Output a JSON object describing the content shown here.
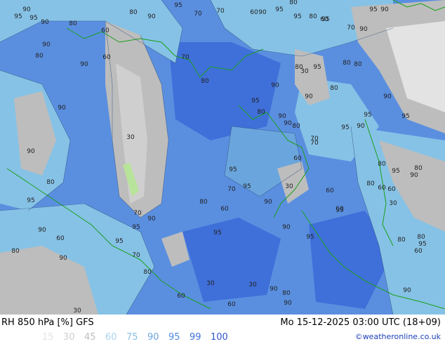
{
  "map": {
    "product": "RH 850 hPa [%] GFS",
    "datetime": "Mo 15-12-2025 03:00 UTC (18+09)",
    "credit": "©weatheronline.co.uk",
    "legend": [
      {
        "label": "15",
        "color": "#e3e3e3"
      },
      {
        "label": "30",
        "color": "#cfcfcf"
      },
      {
        "label": "45",
        "color": "#bdbdbd"
      },
      {
        "label": "60",
        "color": "#a8d4ee"
      },
      {
        "label": "75",
        "color": "#86c2e6"
      },
      {
        "label": "90",
        "color": "#6aa6dd"
      },
      {
        "label": "95",
        "color": "#5088dd"
      },
      {
        "label": "99",
        "color": "#3f6fd9"
      },
      {
        "label": "100",
        "color": "#2f55cf"
      }
    ],
    "contour_labels": [
      "90",
      "95",
      "95",
      "90",
      "80",
      "60",
      "80",
      "90",
      "95",
      "70",
      "70",
      "60",
      "95",
      "90",
      "80",
      "95",
      "60",
      "80",
      "90",
      "95",
      "90",
      "70",
      "80",
      "80",
      "95",
      "90",
      "80",
      "60",
      "70",
      "90",
      "80",
      "90",
      "80",
      "30",
      "95",
      "80",
      "90",
      "95",
      "80",
      "90",
      "90",
      "80",
      "70",
      "95",
      "95",
      "90",
      "90",
      "95",
      "90",
      "80",
      "30",
      "95",
      "30",
      "95",
      "90",
      "70",
      "90",
      "80",
      "60",
      "95",
      "90",
      "60",
      "60",
      "30",
      "95",
      "70",
      "80",
      "60",
      "90",
      "60",
      "80",
      "95",
      "60",
      "80",
      "95",
      "70",
      "80",
      "60",
      "30",
      "60",
      "90",
      "80",
      "30",
      "90",
      "90",
      "95",
      "80",
      "95",
      "60",
      "60",
      "90",
      "30",
      "90",
      "95",
      "70",
      "90",
      "95",
      "80",
      "80",
      "30"
    ]
  }
}
